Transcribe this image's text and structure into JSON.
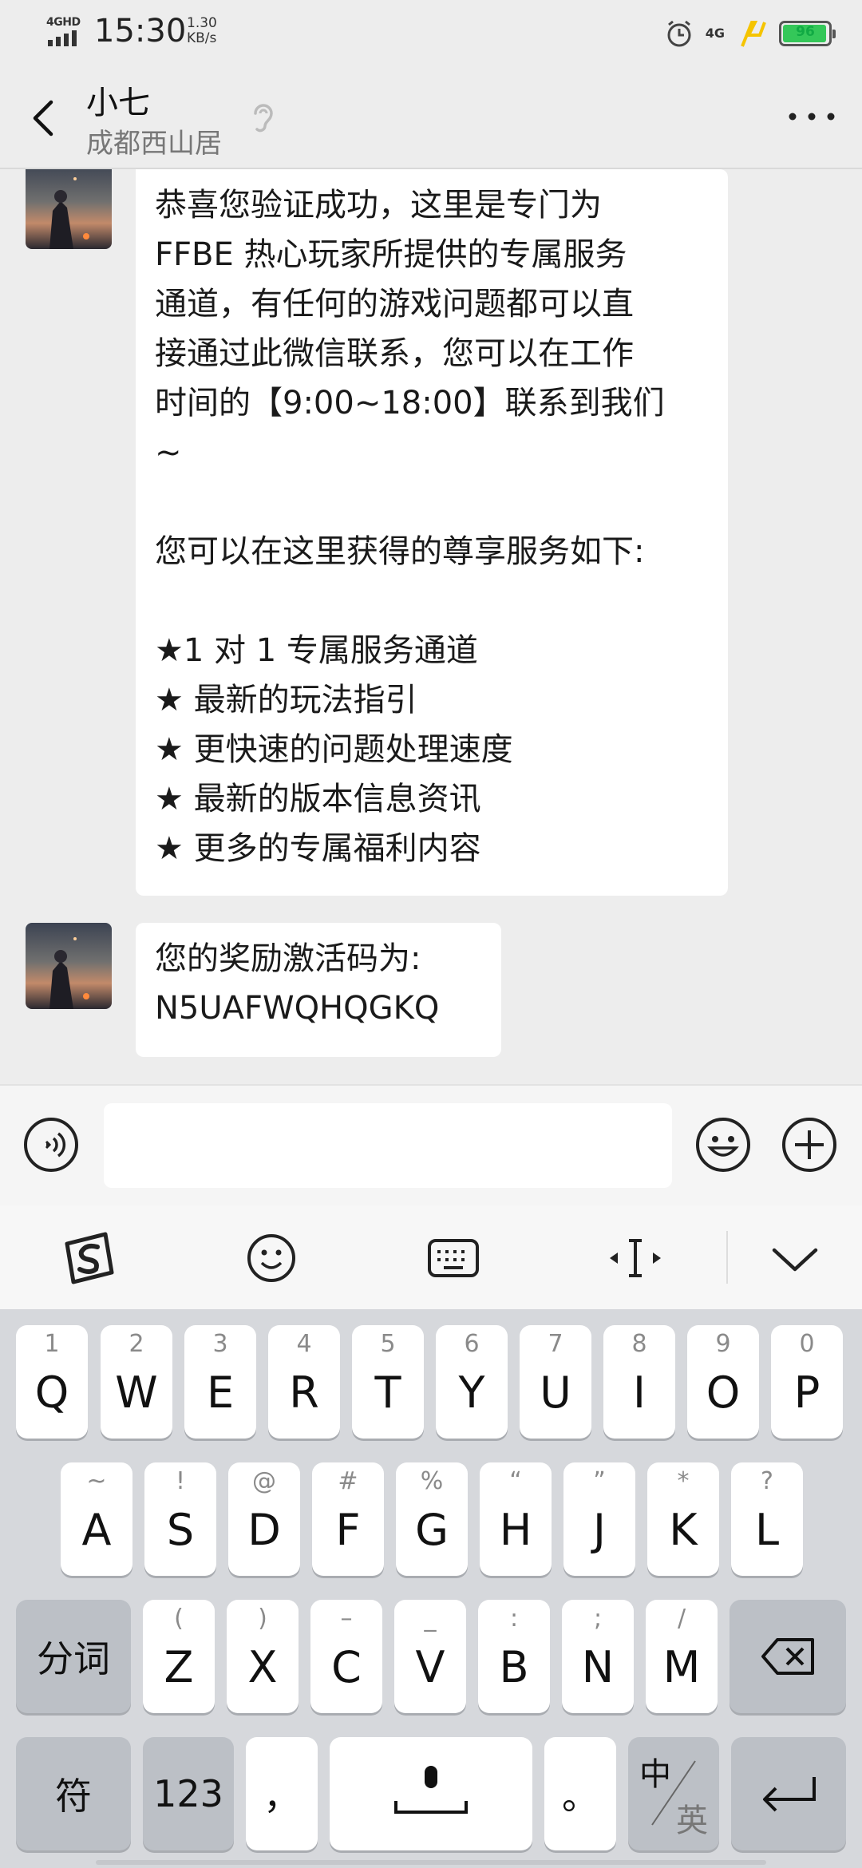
{
  "status": {
    "network_tag": "4GHD",
    "time": "15:30",
    "speed_value": "1.30",
    "speed_unit": "KB/s",
    "net_right": "4G",
    "battery": "96"
  },
  "header": {
    "title": "小七",
    "subtitle": "成都西山居"
  },
  "messages": [
    {
      "text": "恭喜您验证成功，这里是专门为\nFFBE 热心玩家所提供的专属服务\n通道，有任何的游戏问题都可以直\n接通过此微信联系，您可以在工作\n时间的【9:00~18:00】联系到我们\n~\n\n您可以在这里获得的尊享服务如下:\n\n★1 对 1 专属服务通道\n★ 最新的玩法指引\n★ 更快速的问题处理速度\n★ 最新的版本信息资讯\n★ 更多的专属福利内容"
    },
    {
      "text": "您的奖励激活码为:\nN5UAFWQHQGKQ"
    }
  ],
  "input": {
    "placeholder": ""
  },
  "keyboard": {
    "row1": [
      {
        "main": "Q",
        "hint": "1"
      },
      {
        "main": "W",
        "hint": "2"
      },
      {
        "main": "E",
        "hint": "3"
      },
      {
        "main": "R",
        "hint": "4"
      },
      {
        "main": "T",
        "hint": "5"
      },
      {
        "main": "Y",
        "hint": "6"
      },
      {
        "main": "U",
        "hint": "7"
      },
      {
        "main": "I",
        "hint": "8"
      },
      {
        "main": "O",
        "hint": "9"
      },
      {
        "main": "P",
        "hint": "0"
      }
    ],
    "row2": [
      {
        "main": "A",
        "hint": "~"
      },
      {
        "main": "S",
        "hint": "!"
      },
      {
        "main": "D",
        "hint": "@"
      },
      {
        "main": "F",
        "hint": "#"
      },
      {
        "main": "G",
        "hint": "%"
      },
      {
        "main": "H",
        "hint": "“"
      },
      {
        "main": "J",
        "hint": "”"
      },
      {
        "main": "K",
        "hint": "*"
      },
      {
        "main": "L",
        "hint": "?"
      }
    ],
    "row3": [
      {
        "main": "Z",
        "hint": "("
      },
      {
        "main": "X",
        "hint": ")"
      },
      {
        "main": "C",
        "hint": "–"
      },
      {
        "main": "V",
        "hint": "_"
      },
      {
        "main": "B",
        "hint": ":"
      },
      {
        "main": "N",
        "hint": ";"
      },
      {
        "main": "M",
        "hint": "/"
      }
    ],
    "fenci": "分词",
    "fu": "符",
    "num": "123",
    "comma": "，",
    "period": "。",
    "zh": "中",
    "en": "英"
  }
}
